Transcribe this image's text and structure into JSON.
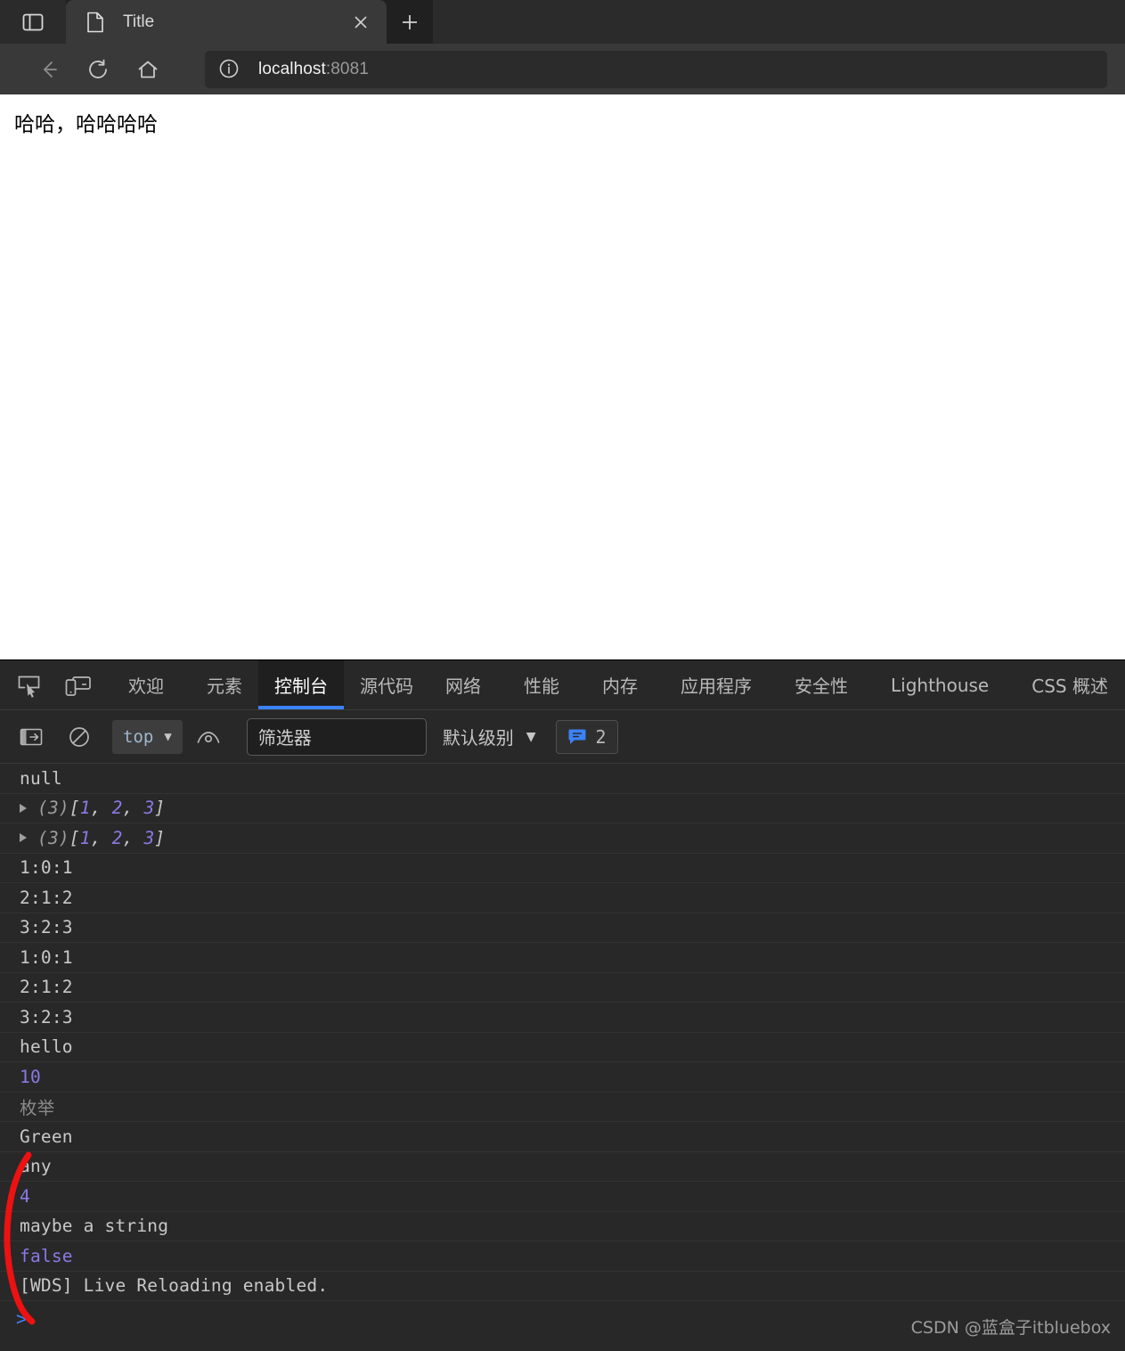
{
  "browser": {
    "sidebar_button": "sidebar-toggle",
    "tab": {
      "title": "Title",
      "close_label": "×"
    },
    "newtab_label": "+",
    "nav": {
      "back": "←",
      "reload": "⟳",
      "home": "⌂"
    },
    "omnibox": {
      "host": "localhost",
      "port": ":8081",
      "info_icon": "site-info"
    }
  },
  "page": {
    "text": "哈哈，哈哈哈哈"
  },
  "devtools": {
    "tabs": [
      {
        "label": "欢迎",
        "active": false
      },
      {
        "label": "元素",
        "active": false
      },
      {
        "label": "控制台",
        "active": true
      },
      {
        "label": "源代码",
        "active": false
      },
      {
        "label": "网络",
        "active": false
      },
      {
        "label": "性能",
        "active": false
      },
      {
        "label": "内存",
        "active": false
      },
      {
        "label": "应用程序",
        "active": false
      },
      {
        "label": "安全性",
        "active": false
      },
      {
        "label": "Lighthouse",
        "active": false
      },
      {
        "label": "CSS 概述",
        "active": false
      }
    ],
    "toolbar": {
      "context_value": "top",
      "context_caret": "▼",
      "filter_placeholder": "筛选器",
      "level_label": "默认级别",
      "level_caret": "▼",
      "message_count": "2"
    },
    "console_rows": [
      {
        "kind": "text",
        "text": "null"
      },
      {
        "kind": "array",
        "length": "(3)",
        "open": "[",
        "items": [
          "1",
          "2",
          "3"
        ],
        "close": "]"
      },
      {
        "kind": "array",
        "length": "(3)",
        "open": "[",
        "items": [
          "1",
          "2",
          "3"
        ],
        "close": "]"
      },
      {
        "kind": "text",
        "text": "1:0:1"
      },
      {
        "kind": "text",
        "text": "2:1:2"
      },
      {
        "kind": "text",
        "text": "3:2:3"
      },
      {
        "kind": "text",
        "text": "1:0:1"
      },
      {
        "kind": "text",
        "text": "2:1:2"
      },
      {
        "kind": "text",
        "text": "3:2:3"
      },
      {
        "kind": "text",
        "text": "hello"
      },
      {
        "kind": "num",
        "text": "10"
      },
      {
        "kind": "cjk",
        "text": "枚举"
      },
      {
        "kind": "text",
        "text": "Green"
      },
      {
        "kind": "text",
        "text": "any"
      },
      {
        "kind": "num",
        "text": "4"
      },
      {
        "kind": "text",
        "text": "maybe a string"
      },
      {
        "kind": "num",
        "text": "false"
      },
      {
        "kind": "text",
        "text": "[WDS] Live Reloading enabled."
      }
    ],
    "prompt_caret": ">"
  },
  "watermark": "CSDN @蓝盒子itbluebox",
  "colors": {
    "accent_blue": "#3b82f6",
    "annotation_red": "#ee1111",
    "console_bg": "#282828",
    "chrome_bg": "#393939"
  }
}
